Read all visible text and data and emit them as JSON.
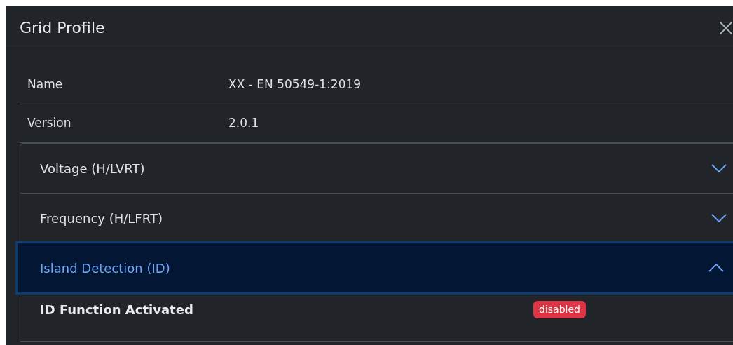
{
  "dialog": {
    "title": "Grid Profile"
  },
  "info_rows": [
    {
      "label": "Name",
      "value": "XX - EN 50549-1:2019"
    },
    {
      "label": "Version",
      "value": "2.0.1"
    }
  ],
  "sections": [
    {
      "title": "Voltage (H/LVRT)",
      "expanded": false
    },
    {
      "title": "Frequency (H/LFRT)",
      "expanded": false
    },
    {
      "title": "Island Detection (ID)",
      "expanded": true,
      "settings": [
        {
          "label": "ID Function Activated",
          "status": "disabled",
          "kind": "danger"
        }
      ]
    }
  ]
}
